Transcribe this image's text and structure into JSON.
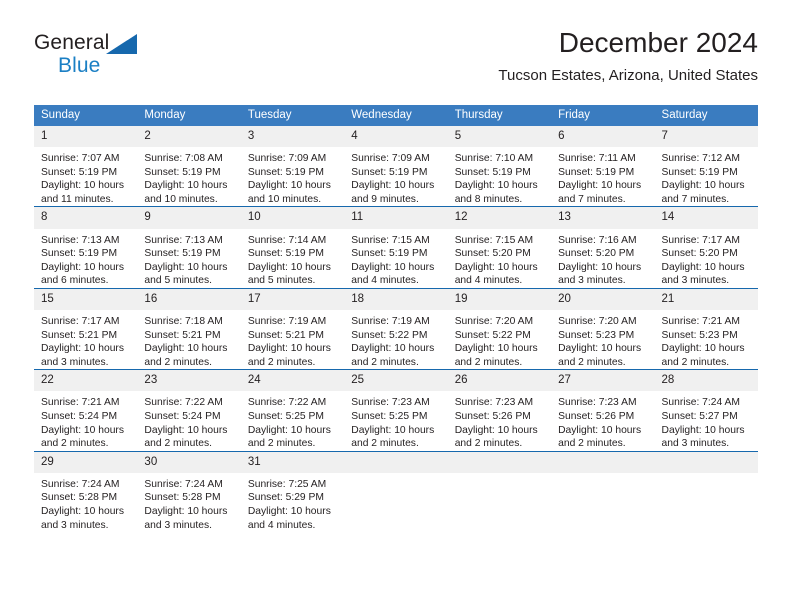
{
  "brand": {
    "name_part1": "General",
    "name_part2": "Blue",
    "accent_color": "#1b7fc4",
    "triangle_color": "#1668ad"
  },
  "header": {
    "title": "December 2024",
    "subtitle": "Tucson Estates, Arizona, United States"
  },
  "calendar": {
    "header_color": "#3a7cc0",
    "daynum_background": "#f0f0f0",
    "weekday_headers": [
      "Sunday",
      "Monday",
      "Tuesday",
      "Wednesday",
      "Thursday",
      "Friday",
      "Saturday"
    ],
    "weeks": [
      [
        {
          "day": "1",
          "lines": [
            "Sunrise: 7:07 AM",
            "Sunset: 5:19 PM",
            "Daylight: 10 hours",
            "and 11 minutes."
          ]
        },
        {
          "day": "2",
          "lines": [
            "Sunrise: 7:08 AM",
            "Sunset: 5:19 PM",
            "Daylight: 10 hours",
            "and 10 minutes."
          ]
        },
        {
          "day": "3",
          "lines": [
            "Sunrise: 7:09 AM",
            "Sunset: 5:19 PM",
            "Daylight: 10 hours",
            "and 10 minutes."
          ]
        },
        {
          "day": "4",
          "lines": [
            "Sunrise: 7:09 AM",
            "Sunset: 5:19 PM",
            "Daylight: 10 hours",
            "and 9 minutes."
          ]
        },
        {
          "day": "5",
          "lines": [
            "Sunrise: 7:10 AM",
            "Sunset: 5:19 PM",
            "Daylight: 10 hours",
            "and 8 minutes."
          ]
        },
        {
          "day": "6",
          "lines": [
            "Sunrise: 7:11 AM",
            "Sunset: 5:19 PM",
            "Daylight: 10 hours",
            "and 7 minutes."
          ]
        },
        {
          "day": "7",
          "lines": [
            "Sunrise: 7:12 AM",
            "Sunset: 5:19 PM",
            "Daylight: 10 hours",
            "and 7 minutes."
          ]
        }
      ],
      [
        {
          "day": "8",
          "lines": [
            "Sunrise: 7:13 AM",
            "Sunset: 5:19 PM",
            "Daylight: 10 hours",
            "and 6 minutes."
          ]
        },
        {
          "day": "9",
          "lines": [
            "Sunrise: 7:13 AM",
            "Sunset: 5:19 PM",
            "Daylight: 10 hours",
            "and 5 minutes."
          ]
        },
        {
          "day": "10",
          "lines": [
            "Sunrise: 7:14 AM",
            "Sunset: 5:19 PM",
            "Daylight: 10 hours",
            "and 5 minutes."
          ]
        },
        {
          "day": "11",
          "lines": [
            "Sunrise: 7:15 AM",
            "Sunset: 5:19 PM",
            "Daylight: 10 hours",
            "and 4 minutes."
          ]
        },
        {
          "day": "12",
          "lines": [
            "Sunrise: 7:15 AM",
            "Sunset: 5:20 PM",
            "Daylight: 10 hours",
            "and 4 minutes."
          ]
        },
        {
          "day": "13",
          "lines": [
            "Sunrise: 7:16 AM",
            "Sunset: 5:20 PM",
            "Daylight: 10 hours",
            "and 3 minutes."
          ]
        },
        {
          "day": "14",
          "lines": [
            "Sunrise: 7:17 AM",
            "Sunset: 5:20 PM",
            "Daylight: 10 hours",
            "and 3 minutes."
          ]
        }
      ],
      [
        {
          "day": "15",
          "lines": [
            "Sunrise: 7:17 AM",
            "Sunset: 5:21 PM",
            "Daylight: 10 hours",
            "and 3 minutes."
          ]
        },
        {
          "day": "16",
          "lines": [
            "Sunrise: 7:18 AM",
            "Sunset: 5:21 PM",
            "Daylight: 10 hours",
            "and 2 minutes."
          ]
        },
        {
          "day": "17",
          "lines": [
            "Sunrise: 7:19 AM",
            "Sunset: 5:21 PM",
            "Daylight: 10 hours",
            "and 2 minutes."
          ]
        },
        {
          "day": "18",
          "lines": [
            "Sunrise: 7:19 AM",
            "Sunset: 5:22 PM",
            "Daylight: 10 hours",
            "and 2 minutes."
          ]
        },
        {
          "day": "19",
          "lines": [
            "Sunrise: 7:20 AM",
            "Sunset: 5:22 PM",
            "Daylight: 10 hours",
            "and 2 minutes."
          ]
        },
        {
          "day": "20",
          "lines": [
            "Sunrise: 7:20 AM",
            "Sunset: 5:23 PM",
            "Daylight: 10 hours",
            "and 2 minutes."
          ]
        },
        {
          "day": "21",
          "lines": [
            "Sunrise: 7:21 AM",
            "Sunset: 5:23 PM",
            "Daylight: 10 hours",
            "and 2 minutes."
          ]
        }
      ],
      [
        {
          "day": "22",
          "lines": [
            "Sunrise: 7:21 AM",
            "Sunset: 5:24 PM",
            "Daylight: 10 hours",
            "and 2 minutes."
          ]
        },
        {
          "day": "23",
          "lines": [
            "Sunrise: 7:22 AM",
            "Sunset: 5:24 PM",
            "Daylight: 10 hours",
            "and 2 minutes."
          ]
        },
        {
          "day": "24",
          "lines": [
            "Sunrise: 7:22 AM",
            "Sunset: 5:25 PM",
            "Daylight: 10 hours",
            "and 2 minutes."
          ]
        },
        {
          "day": "25",
          "lines": [
            "Sunrise: 7:23 AM",
            "Sunset: 5:25 PM",
            "Daylight: 10 hours",
            "and 2 minutes."
          ]
        },
        {
          "day": "26",
          "lines": [
            "Sunrise: 7:23 AM",
            "Sunset: 5:26 PM",
            "Daylight: 10 hours",
            "and 2 minutes."
          ]
        },
        {
          "day": "27",
          "lines": [
            "Sunrise: 7:23 AM",
            "Sunset: 5:26 PM",
            "Daylight: 10 hours",
            "and 2 minutes."
          ]
        },
        {
          "day": "28",
          "lines": [
            "Sunrise: 7:24 AM",
            "Sunset: 5:27 PM",
            "Daylight: 10 hours",
            "and 3 minutes."
          ]
        }
      ],
      [
        {
          "day": "29",
          "lines": [
            "Sunrise: 7:24 AM",
            "Sunset: 5:28 PM",
            "Daylight: 10 hours",
            "and 3 minutes."
          ]
        },
        {
          "day": "30",
          "lines": [
            "Sunrise: 7:24 AM",
            "Sunset: 5:28 PM",
            "Daylight: 10 hours",
            "and 3 minutes."
          ]
        },
        {
          "day": "31",
          "lines": [
            "Sunrise: 7:25 AM",
            "Sunset: 5:29 PM",
            "Daylight: 10 hours",
            "and 4 minutes."
          ]
        },
        {
          "day": "",
          "lines": []
        },
        {
          "day": "",
          "lines": []
        },
        {
          "day": "",
          "lines": []
        },
        {
          "day": "",
          "lines": []
        }
      ]
    ]
  }
}
